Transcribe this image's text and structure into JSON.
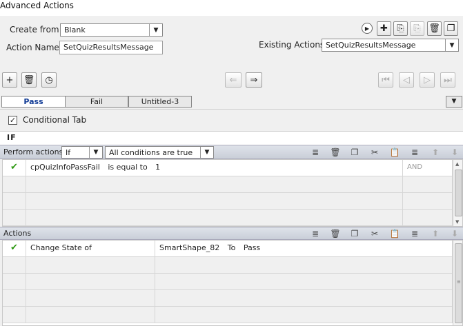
{
  "window": {
    "title": "Advanced Actions"
  },
  "form": {
    "create_from_label": "Create from:",
    "create_from_value": "Blank",
    "action_name_label": "Action Name:",
    "action_name_value": "SetQuizResultsMessage",
    "existing_actions_label": "Existing Actions:",
    "existing_actions_value": "SetQuizResultsMessage"
  },
  "tabs": [
    {
      "label": "Pass",
      "active": true
    },
    {
      "label": "Fail",
      "active": false
    },
    {
      "label": "Untitled-3",
      "active": false
    }
  ],
  "conditional": {
    "label": "Conditional Tab",
    "checked": true
  },
  "if_label": "IF",
  "perform": {
    "label": "Perform actions:",
    "mode_value": "If",
    "conditions_value": "All conditions are true"
  },
  "conditions": [
    {
      "variable": "cpQuizInfoPassFail",
      "operator": "is equal to",
      "value": "1",
      "join": "AND"
    }
  ],
  "actions_header": "Actions",
  "actions": [
    {
      "action": "Change State of",
      "target": "SmartShape_82",
      "to_label": "To",
      "state": "Pass"
    }
  ],
  "colors": {
    "accent": "#123c96",
    "check": "#2f9a14",
    "bar": "#d3d8e1"
  }
}
